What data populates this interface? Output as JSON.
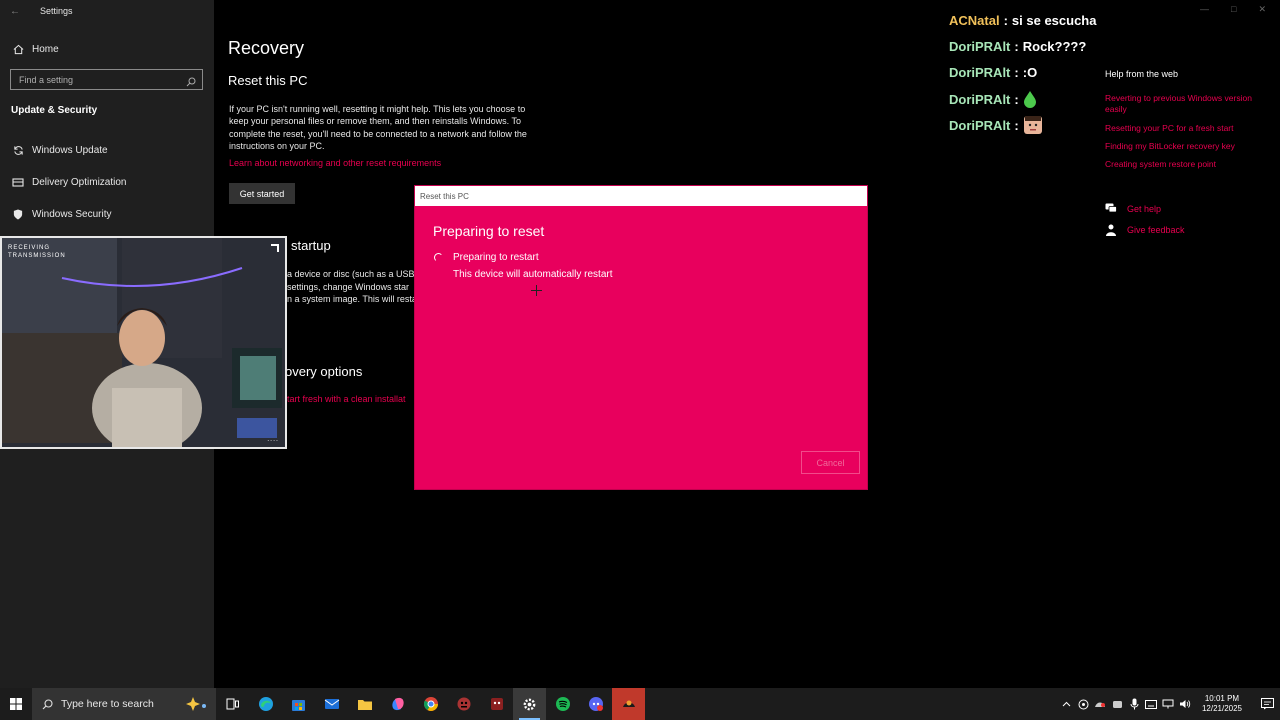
{
  "settings_window": {
    "title": "Settings",
    "sidebar": {
      "home": "Home",
      "search_placeholder": "Find a setting",
      "section": "Update & Security",
      "items": [
        {
          "label": "Windows Update",
          "icon": "sync-icon"
        },
        {
          "label": "Delivery Optimization",
          "icon": "delivery-icon"
        },
        {
          "label": "Windows Security",
          "icon": "shield-icon"
        }
      ]
    },
    "main": {
      "title": "Recovery",
      "reset_heading": "Reset this PC",
      "reset_body": "If your PC isn't running well, resetting it might help. This lets you choose to keep your personal files or remove them, and then reinstalls Windows. To complete the reset, you'll need to be connected to a network and follow the instructions on your PC.",
      "reset_link": "Learn about networking and other reset requirements",
      "get_started": "Get started",
      "startup_heading": "startup",
      "startup_lines": [
        "a device or disc (such as a USB",
        "settings, change Windows star",
        "n a system image. This will resta"
      ],
      "more_heading": "overy options",
      "more_link": "tart fresh with a clean installat"
    }
  },
  "webcam": {
    "overlay_text_1": "RECEIVING",
    "overlay_text_2": "TRANSMISSION",
    "dots": "...."
  },
  "dialog": {
    "title": "Reset this PC",
    "heading": "Preparing to reset",
    "line1": "Preparing to restart",
    "line2": "This device will automatically restart",
    "cancel": "Cancel",
    "bg_color": "#e8005d"
  },
  "chat": [
    {
      "user": "ACNatal",
      "color": "#f0c05a",
      "message": "si se escucha"
    },
    {
      "user": "DoriPRAlt",
      "color": "#a8e6b8",
      "message": "Rock????"
    },
    {
      "user": "DoriPRAlt",
      "color": "#a8e6b8",
      "message": ":O"
    },
    {
      "user": "DoriPRAlt",
      "color": "#a8e6b8",
      "message": "",
      "emote": "green-drop-emote"
    },
    {
      "user": "DoriPRAlt",
      "color": "#a8e6b8",
      "message": "",
      "emote": "face-emote"
    }
  ],
  "help": {
    "title": "Help from the web",
    "links": [
      "Reverting to previous Windows version easily",
      "Resetting your PC for a fresh start",
      "Finding my BitLocker recovery key",
      "Creating system restore point"
    ],
    "get_help": "Get help",
    "give_feedback": "Give feedback"
  },
  "taskbar": {
    "search_placeholder": "Type here to search",
    "time": "10:01 PM",
    "date": "12/21/2025",
    "apps": [
      "task-view-icon",
      "edge-icon",
      "store-icon",
      "mail-icon",
      "file-explorer-icon",
      "copilot-icon",
      "chrome-icon",
      "game-icon-1",
      "game-icon-2",
      "settings-icon",
      "spotify-icon",
      "discord-icon",
      "app-icon"
    ]
  }
}
